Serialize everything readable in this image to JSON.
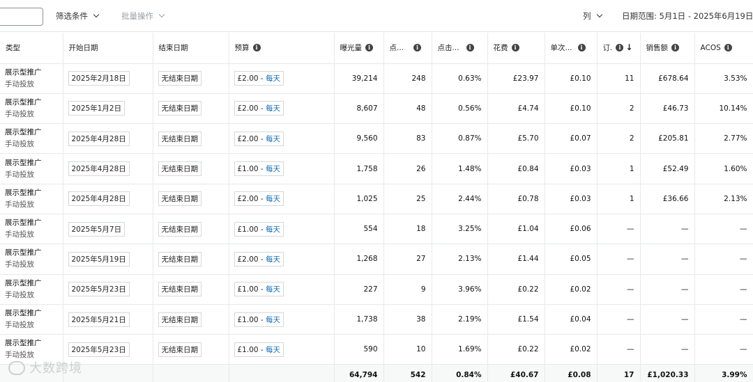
{
  "toolbar": {
    "filter_label": "筛选条件",
    "bulk_label": "批量操作",
    "columns_label": "列",
    "date_range": "日期范围: 5月1日 - 2025年6月19日"
  },
  "columns": {
    "type": "类型",
    "start": "开始日期",
    "end": "结束日期",
    "budget": "预算",
    "impressions": "曝光量",
    "clicks": "点...",
    "ctr": "点击...",
    "spend": "花费",
    "cpc": "单次...",
    "orders": "订.",
    "sales": "销售额",
    "acos": "ACOS"
  },
  "rows": [
    {
      "type1": "展示型推广",
      "type2": "手动投放",
      "start": "2025年2月18日",
      "end": "无结束日期",
      "budget_amt": "£2.00",
      "budget_sep": " - ",
      "budget_unit": "每天",
      "impressions": "39,214",
      "clicks": "248",
      "ctr": "0.63%",
      "spend": "£23.97",
      "cpc": "£0.10",
      "orders": "11",
      "sales": "£678.64",
      "acos": "3.53%"
    },
    {
      "type1": "展示型推广",
      "type2": "手动投放",
      "start": "2025年1月2日",
      "end": "无结束日期",
      "budget_amt": "£2.00",
      "budget_sep": " - ",
      "budget_unit": "每天",
      "impressions": "8,607",
      "clicks": "48",
      "ctr": "0.56%",
      "spend": "£4.74",
      "cpc": "£0.10",
      "orders": "2",
      "sales": "£46.73",
      "acos": "10.14%"
    },
    {
      "type1": "展示型推广",
      "type2": "手动投放",
      "start": "2025年4月28日",
      "end": "无结束日期",
      "budget_amt": "£2.00",
      "budget_sep": " - ",
      "budget_unit": "每天",
      "impressions": "9,560",
      "clicks": "83",
      "ctr": "0.87%",
      "spend": "£5.70",
      "cpc": "£0.07",
      "orders": "2",
      "sales": "£205.81",
      "acos": "2.77%"
    },
    {
      "type1": "展示型推广",
      "type2": "手动投放",
      "start": "2025年4月28日",
      "end": "无结束日期",
      "budget_amt": "£1.00",
      "budget_sep": " - ",
      "budget_unit": "每天",
      "impressions": "1,758",
      "clicks": "26",
      "ctr": "1.48%",
      "spend": "£0.84",
      "cpc": "£0.03",
      "orders": "1",
      "sales": "£52.49",
      "acos": "1.60%"
    },
    {
      "type1": "展示型推广",
      "type2": "手动投放",
      "start": "2025年4月28日",
      "end": "无结束日期",
      "budget_amt": "£2.00",
      "budget_sep": " - ",
      "budget_unit": "每天",
      "impressions": "1,025",
      "clicks": "25",
      "ctr": "2.44%",
      "spend": "£0.78",
      "cpc": "£0.03",
      "orders": "1",
      "sales": "£36.66",
      "acos": "2.13%"
    },
    {
      "type1": "展示型推广",
      "type2": "手动投放",
      "start": "2025年5月7日",
      "end": "无结束日期",
      "budget_amt": "£1.00",
      "budget_sep": " - ",
      "budget_unit": "每天",
      "impressions": "554",
      "clicks": "18",
      "ctr": "3.25%",
      "spend": "£1.04",
      "cpc": "£0.06",
      "orders": "—",
      "sales": "—",
      "acos": "—"
    },
    {
      "type1": "展示型推广",
      "type2": "手动投放",
      "start": "2025年5月19日",
      "end": "无结束日期",
      "budget_amt": "£2.00",
      "budget_sep": " - ",
      "budget_unit": "每天",
      "impressions": "1,268",
      "clicks": "27",
      "ctr": "2.13%",
      "spend": "£1.44",
      "cpc": "£0.05",
      "orders": "—",
      "sales": "—",
      "acos": "—"
    },
    {
      "type1": "展示型推广",
      "type2": "手动投放",
      "start": "2025年5月23日",
      "end": "无结束日期",
      "budget_amt": "£1.00",
      "budget_sep": " - ",
      "budget_unit": "每天",
      "impressions": "227",
      "clicks": "9",
      "ctr": "3.96%",
      "spend": "£0.22",
      "cpc": "£0.02",
      "orders": "—",
      "sales": "—",
      "acos": "—"
    },
    {
      "type1": "展示型推广",
      "type2": "手动投放",
      "start": "2025年5月21日",
      "end": "无结束日期",
      "budget_amt": "£1.00",
      "budget_sep": " - ",
      "budget_unit": "每天",
      "impressions": "1,738",
      "clicks": "38",
      "ctr": "2.19%",
      "spend": "£1.54",
      "cpc": "£0.04",
      "orders": "—",
      "sales": "—",
      "acos": "—"
    },
    {
      "type1": "展示型推广",
      "type2": "手动投放",
      "start": "2025年5月23日",
      "end": "无结束日期",
      "budget_amt": "£1.00",
      "budget_sep": " - ",
      "budget_unit": "每天",
      "impressions": "590",
      "clicks": "10",
      "ctr": "1.69%",
      "spend": "£0.22",
      "cpc": "£0.02",
      "orders": "—",
      "sales": "—",
      "acos": "—"
    }
  ],
  "totals": {
    "impressions": "64,794",
    "clicks": "542",
    "ctr": "0.84%",
    "spend": "£40.67",
    "cpc": "£0.08",
    "orders": "17",
    "sales": "£1,020.33",
    "acos": "3.99%"
  },
  "watermark": "大数跨境"
}
